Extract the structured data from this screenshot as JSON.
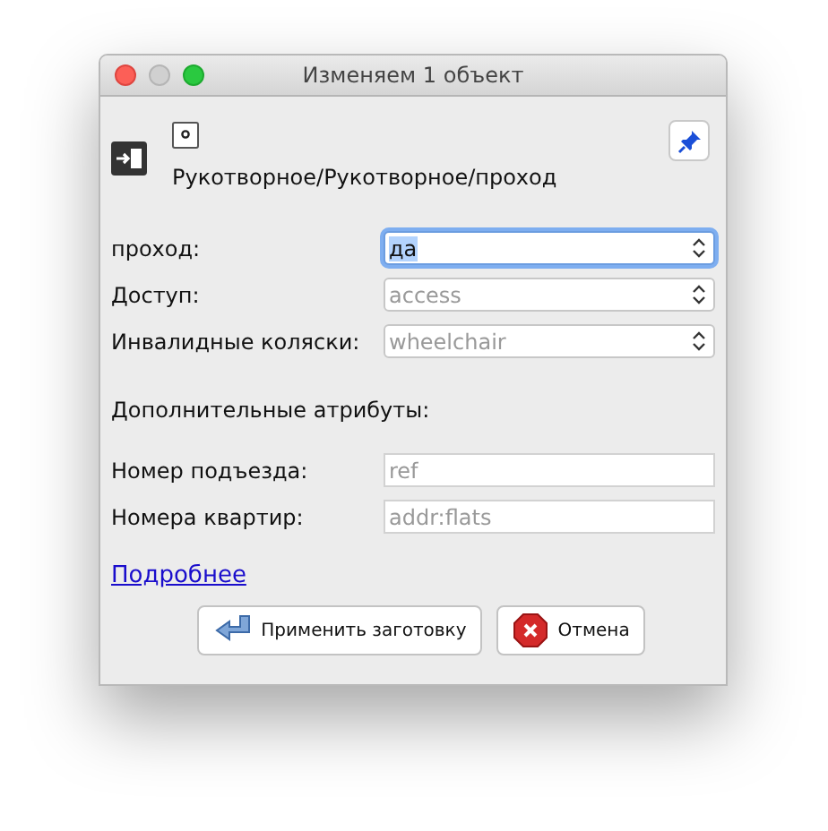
{
  "window": {
    "title": "Изменяем 1 объект"
  },
  "preset_path": "Рукотворное/Рукотворное/проход",
  "fields": [
    {
      "label": "проход:",
      "kind": "combo",
      "value": "да",
      "selected": true
    },
    {
      "label": "Доступ:",
      "kind": "combo",
      "placeholder": "access",
      "selected": false
    },
    {
      "label": "Инвалидные коляски:",
      "kind": "combo",
      "placeholder": "wheelchair",
      "selected": false
    }
  ],
  "additional_heading": "Дополнительные атрибуты:",
  "additional_fields": [
    {
      "label": "Номер подъезда:",
      "placeholder": "ref"
    },
    {
      "label": "Номера квартир:",
      "placeholder": "addr:flats"
    }
  ],
  "more_link": "Подробнее",
  "buttons": [
    {
      "label": "Применить заготовку",
      "kind": "apply"
    },
    {
      "label": "Отмена",
      "kind": "cancel"
    }
  ]
}
